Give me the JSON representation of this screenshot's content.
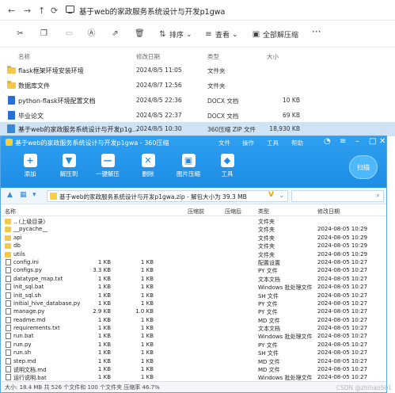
{
  "explorer": {
    "path": "基于web的家政服务系统设计与开发p1gwa",
    "toolbar": {
      "sort": "排序",
      "view": "查看",
      "extract": "全部解压缩"
    },
    "columns": {
      "name": "名称",
      "date": "修改日期",
      "type": "类型",
      "size": "大小"
    },
    "rows": [
      {
        "name": "flask框架环境安装环境",
        "date": "2024/8/5 11:05",
        "type": "文件夹",
        "size": "",
        "icon": "folder-icon"
      },
      {
        "name": "数据库文件",
        "date": "2024/8/7 12:56",
        "type": "文件夹",
        "size": "",
        "icon": "folder-icon"
      },
      {
        "name": "python-flask环境配置文档",
        "date": "2024/8/5 22:36",
        "type": "DOCX 文档",
        "size": "10 KB",
        "icon": "docx-icon"
      },
      {
        "name": "毕业论文",
        "date": "2024/8/5 22:37",
        "type": "DOCX 文档",
        "size": "69 KB",
        "icon": "docx-icon"
      },
      {
        "name": "基于web的家政服务系统设计与开发p1g...",
        "date": "2024/8/5 10:30",
        "type": "360压缩 ZIP 文件",
        "size": "18,930 KB",
        "icon": "zip-icon"
      }
    ]
  },
  "zip": {
    "title": "基于web的家政服务系统设计与开发p1gwa - 360压缩",
    "menu": [
      "文件",
      "操作",
      "工具",
      "帮助"
    ],
    "tools": [
      {
        "label": "添加",
        "icon": "add-icon",
        "glyph": "+"
      },
      {
        "label": "解压到",
        "icon": "extract-to-icon",
        "glyph": "▼"
      },
      {
        "label": "一键解压",
        "icon": "one-click-extract-icon",
        "glyph": "—"
      },
      {
        "label": "删除",
        "icon": "delete-icon",
        "glyph": "✕"
      },
      {
        "label": "图片压缩",
        "icon": "image-compress-icon",
        "glyph": "▣"
      },
      {
        "label": "工具",
        "icon": "toolbox-icon",
        "glyph": "◆"
      }
    ],
    "scan": "扫描",
    "address": "基于web的家政服务系统设计与开发p1gwa.zip - 解包大小为 39.3 MB",
    "columns": {
      "name": "名称",
      "compressed": "压缩前",
      "original": "压缩后",
      "type": "类型",
      "date": "修改日期"
    },
    "rows": [
      {
        "name": ".. (上级目录)",
        "c": "",
        "o": "",
        "type": "文件夹",
        "date": "",
        "icon": "folder"
      },
      {
        "name": "__pycache__",
        "c": "",
        "o": "",
        "type": "文件夹",
        "date": "2024-08-05 10:29",
        "icon": "folder"
      },
      {
        "name": "api",
        "c": "",
        "o": "",
        "type": "文件夹",
        "date": "2024-08-05 10:29",
        "icon": "folder"
      },
      {
        "name": "db",
        "c": "",
        "o": "",
        "type": "文件夹",
        "date": "2024-08-05 10:29",
        "icon": "folder"
      },
      {
        "name": "utils",
        "c": "",
        "o": "",
        "type": "文件夹",
        "date": "2024-08-05 10:29",
        "icon": "folder"
      },
      {
        "name": "config.ini",
        "c": "1 KB",
        "o": "1 KB",
        "type": "配置设置",
        "date": "2024-08-05 10:27",
        "icon": "file"
      },
      {
        "name": "configs.py",
        "c": "3.3 KB",
        "o": "1 KB",
        "type": "PY 文件",
        "date": "2024-08-05 10:27",
        "icon": "file"
      },
      {
        "name": "datatype_map.txt",
        "c": "1 KB",
        "o": "1 KB",
        "type": "文本文档",
        "date": "2024-08-05 10:27",
        "icon": "file"
      },
      {
        "name": "init_sql.bat",
        "c": "1 KB",
        "o": "1 KB",
        "type": "Windows 批处理文件",
        "date": "2024-08-05 10:27",
        "icon": "file"
      },
      {
        "name": "init_sql.sh",
        "c": "1 KB",
        "o": "1 KB",
        "type": "SH 文件",
        "date": "2024-08-05 10:27",
        "icon": "file"
      },
      {
        "name": "initial_hive_database.py",
        "c": "1 KB",
        "o": "1 KB",
        "type": "PY 文件",
        "date": "2024-08-05 10:27",
        "icon": "file"
      },
      {
        "name": "manage.py",
        "c": "2.9 KB",
        "o": "1.0 KB",
        "type": "PY 文件",
        "date": "2024-08-05 10:27",
        "icon": "file"
      },
      {
        "name": "readme.md",
        "c": "1 KB",
        "o": "1 KB",
        "type": "MD 文件",
        "date": "2024-08-05 10:27",
        "icon": "file"
      },
      {
        "name": "requirements.txt",
        "c": "1 KB",
        "o": "1 KB",
        "type": "文本文档",
        "date": "2024-08-05 10:27",
        "icon": "file"
      },
      {
        "name": "run.bat",
        "c": "1 KB",
        "o": "1 KB",
        "type": "Windows 批处理文件",
        "date": "2024-08-05 10:27",
        "icon": "file"
      },
      {
        "name": "run.py",
        "c": "1 KB",
        "o": "1 KB",
        "type": "PY 文件",
        "date": "2024-08-05 10:27",
        "icon": "file"
      },
      {
        "name": "run.sh",
        "c": "1 KB",
        "o": "1 KB",
        "type": "SH 文件",
        "date": "2024-08-05 10:27",
        "icon": "file"
      },
      {
        "name": "step.md",
        "c": "1 KB",
        "o": "1 KB",
        "type": "MD 文件",
        "date": "2024-08-05 10:27",
        "icon": "file"
      },
      {
        "name": "说明文档.md",
        "c": "1 KB",
        "o": "1 KB",
        "type": "MD 文件",
        "date": "2024-08-05 10:27",
        "icon": "file"
      },
      {
        "name": "运行说明.bat",
        "c": "1 KB",
        "o": "1 KB",
        "type": "Windows 批处理文件",
        "date": "2024-08-05 10:27",
        "icon": "file"
      }
    ],
    "status": "大小: 18.4 MB 共 526 个文件和 100 个文件夹 压缩率 46.7%"
  },
  "watermark": "CSDN @zhihao501"
}
